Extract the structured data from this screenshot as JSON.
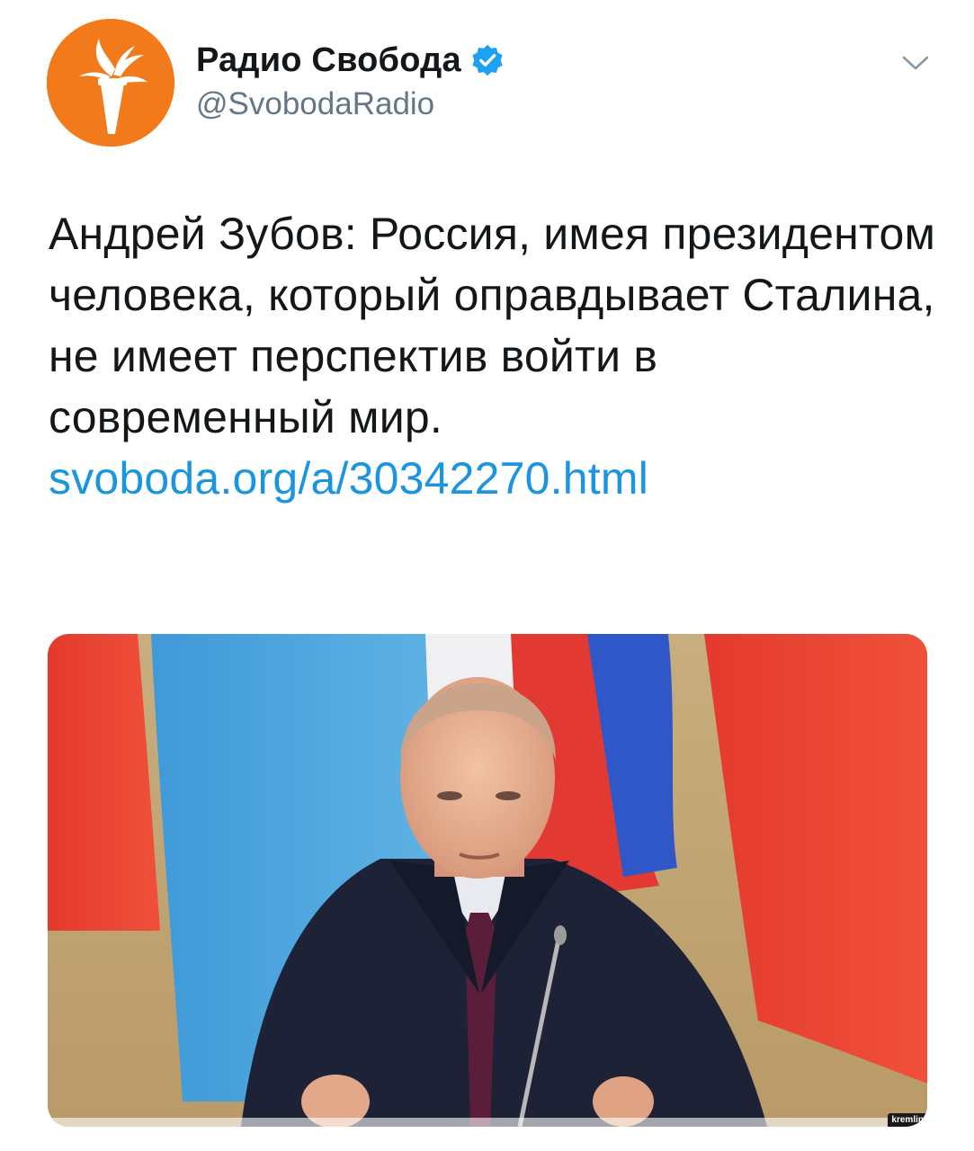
{
  "author": {
    "display_name": "Радио Свобода",
    "handle": "@SvobodaRadio",
    "verified": true,
    "avatar_icon": "torch-logo-icon",
    "avatar_color": "#f27a1a"
  },
  "menu": {
    "icon": "chevron-down-icon"
  },
  "tweet": {
    "text": "Андрей Зубов: Россия, имея президентом человека, который оправдывает Сталина, не имеет перспектив войти в современный мир.",
    "link": "svoboda.org/a/30342270.html",
    "link_color": "#1b95e0"
  },
  "media": {
    "credit": "kremlin"
  },
  "colors": {
    "verified_badge": "#1da1f2",
    "secondary_text": "#657786",
    "primary_text": "#14171a"
  }
}
